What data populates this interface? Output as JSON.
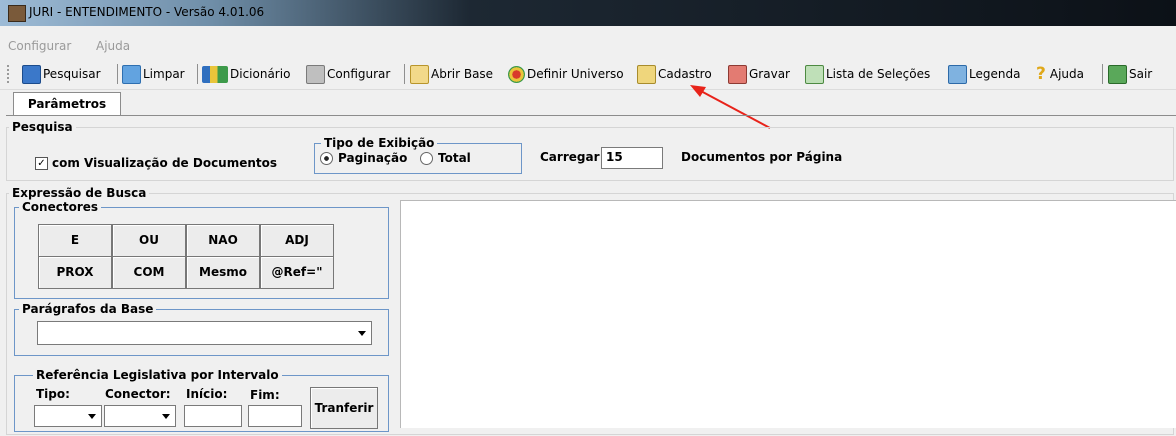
{
  "window": {
    "title": "JURI - ENTENDIMENTO - Versão 4.01.06"
  },
  "menu": {
    "items": [
      "Configurar",
      "Ajuda"
    ]
  },
  "toolbar": {
    "pesquisar": "Pesquisar",
    "limpar": "Limpar",
    "dicionario": "Dicionário",
    "configurar": "Configurar",
    "abrir_base": "Abrir Base",
    "definir_universo": "Definir Universo",
    "cadastro": "Cadastro",
    "gravar": "Gravar",
    "lista_selecoes": "Lista de Seleções",
    "legenda": "Legenda",
    "ajuda": "Ajuda",
    "sair": "Sair"
  },
  "tabs": {
    "parametros": "Parâmetros"
  },
  "pesquisa": {
    "title": "Pesquisa",
    "visualizacao_label": "com Visualização de Documentos",
    "visualizacao_checked": true,
    "tipo_exibicao": {
      "title": "Tipo de Exibição",
      "paginacao": "Paginação",
      "total": "Total",
      "selected": "Paginação"
    },
    "carregar_label": "Carregar",
    "carregar_value": "15",
    "documentos_label": "Documentos por Página"
  },
  "expressao": {
    "title": "Expressão de Busca",
    "conectores": {
      "title": "Conectores",
      "row1": [
        "E",
        "OU",
        "NAO",
        "ADJ"
      ],
      "row2": [
        "PROX",
        "COM",
        "Mesmo",
        "@Ref=\""
      ]
    },
    "paragrafos": {
      "title": "Parágrafos da Base",
      "value": ""
    },
    "referencia": {
      "title": "Referência Legislativa por Intervalo",
      "tipo_label": "Tipo:",
      "conector_label": "Conector:",
      "inicio_label": "Início:",
      "fim_label": "Fim:",
      "transferir_label": "Tranferir"
    }
  },
  "colors": {
    "annotation_arrow": "#e8231a",
    "group_border": "#6d96c8"
  }
}
